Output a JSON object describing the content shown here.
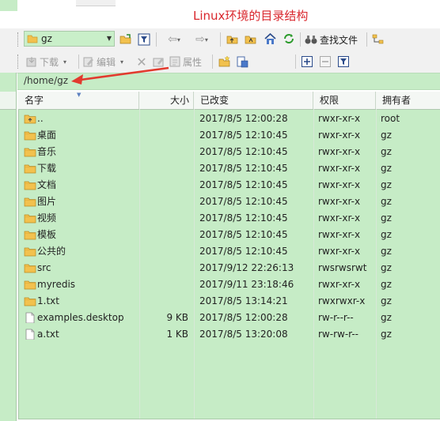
{
  "annotation": {
    "title": "Linux环境的目录结构"
  },
  "toolbar1": {
    "location_value": "gz",
    "search_label": "查找文件"
  },
  "toolbar2": {
    "download_label": "下载",
    "edit_label": "编辑",
    "properties_label": "属性"
  },
  "path": {
    "current": "/home/gz"
  },
  "columns": {
    "name": "名字",
    "size": "大小",
    "modified": "已改变",
    "permissions": "权限",
    "owner": "拥有者"
  },
  "files": [
    {
      "name": "..",
      "size": "",
      "modified": "2017/8/5 12:00:28",
      "permissions": "rwxr-xr-x",
      "owner": "root",
      "icon": "parent-folder-icon"
    },
    {
      "name": "桌面",
      "size": "",
      "modified": "2017/8/5 12:10:45",
      "permissions": "rwxr-xr-x",
      "owner": "gz",
      "icon": "folder-icon"
    },
    {
      "name": "音乐",
      "size": "",
      "modified": "2017/8/5 12:10:45",
      "permissions": "rwxr-xr-x",
      "owner": "gz",
      "icon": "folder-icon"
    },
    {
      "name": "下载",
      "size": "",
      "modified": "2017/8/5 12:10:45",
      "permissions": "rwxr-xr-x",
      "owner": "gz",
      "icon": "folder-icon"
    },
    {
      "name": "文档",
      "size": "",
      "modified": "2017/8/5 12:10:45",
      "permissions": "rwxr-xr-x",
      "owner": "gz",
      "icon": "folder-icon"
    },
    {
      "name": "图片",
      "size": "",
      "modified": "2017/8/5 12:10:45",
      "permissions": "rwxr-xr-x",
      "owner": "gz",
      "icon": "folder-icon"
    },
    {
      "name": "视频",
      "size": "",
      "modified": "2017/8/5 12:10:45",
      "permissions": "rwxr-xr-x",
      "owner": "gz",
      "icon": "folder-icon"
    },
    {
      "name": "模板",
      "size": "",
      "modified": "2017/8/5 12:10:45",
      "permissions": "rwxr-xr-x",
      "owner": "gz",
      "icon": "folder-icon"
    },
    {
      "name": "公共的",
      "size": "",
      "modified": "2017/8/5 12:10:45",
      "permissions": "rwxr-xr-x",
      "owner": "gz",
      "icon": "folder-icon"
    },
    {
      "name": "src",
      "size": "",
      "modified": "2017/9/12 22:26:13",
      "permissions": "rwsrwsrwt",
      "owner": "gz",
      "icon": "folder-icon"
    },
    {
      "name": "myredis",
      "size": "",
      "modified": "2017/9/11 23:18:46",
      "permissions": "rwxr-xr-x",
      "owner": "gz",
      "icon": "folder-icon"
    },
    {
      "name": "1.txt",
      "size": "",
      "modified": "2017/8/5 13:14:21",
      "permissions": "rwxrwxr-x",
      "owner": "gz",
      "icon": "folder-icon"
    },
    {
      "name": "examples.desktop",
      "size": "9 KB",
      "modified": "2017/8/5 12:00:28",
      "permissions": "rw-r--r--",
      "owner": "gz",
      "icon": "file-icon"
    },
    {
      "name": "a.txt",
      "size": "1 KB",
      "modified": "2017/8/5 13:20:08",
      "permissions": "rw-rw-r--",
      "owner": "gz",
      "icon": "file-icon"
    }
  ],
  "colors": {
    "panel_bg": "#c6ecc6",
    "annotation_red": "#d9262c",
    "folder_yellow": "#f2c14e"
  }
}
